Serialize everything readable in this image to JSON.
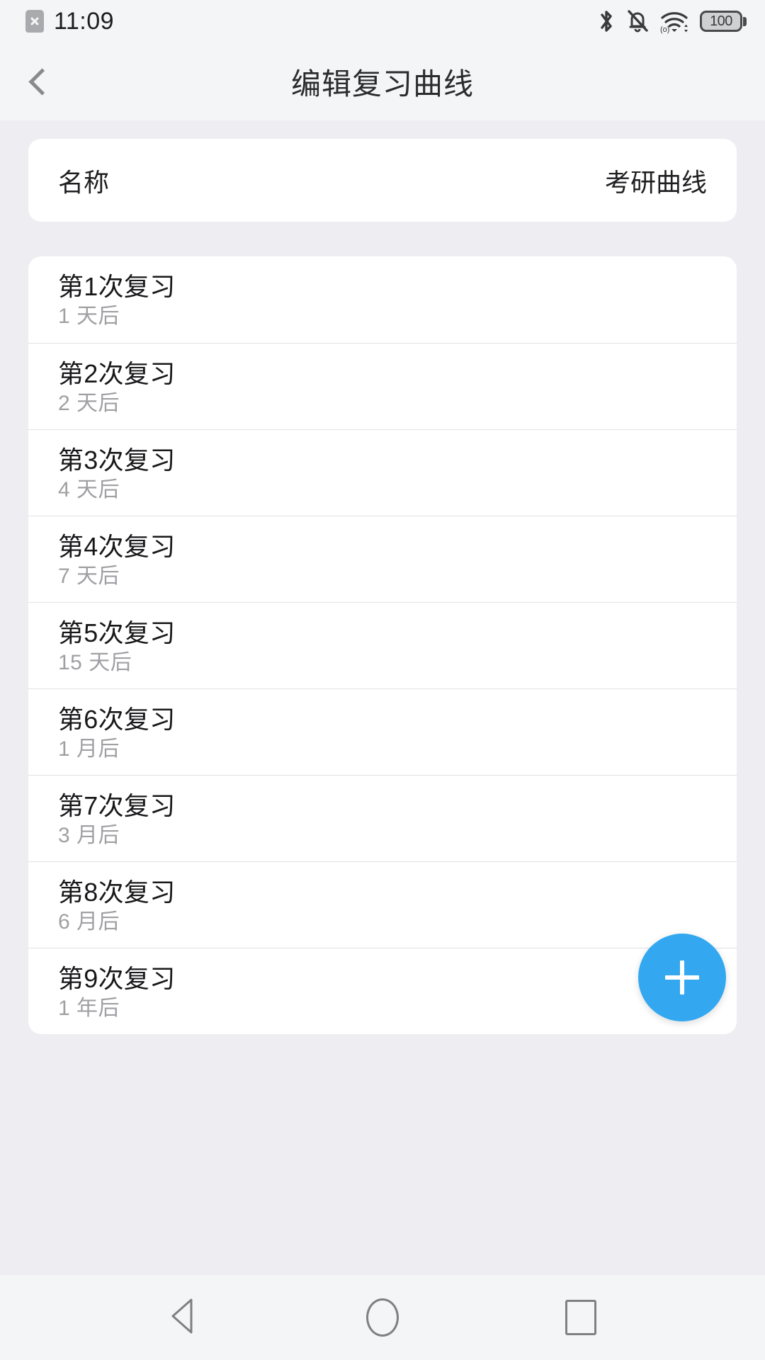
{
  "status_bar": {
    "sim_icon": "sim-card-off-icon",
    "time": "11:09",
    "icons": [
      "bluetooth-icon",
      "notifications-off-icon",
      "wifi-icon"
    ],
    "battery_level": "100"
  },
  "header": {
    "back_icon": "back-chevron-icon",
    "title": "编辑复习曲线"
  },
  "name_card": {
    "label": "名称",
    "value": "考研曲线"
  },
  "review_list": [
    {
      "title": "第1次复习",
      "interval": "1 天后"
    },
    {
      "title": "第2次复习",
      "interval": "2 天后"
    },
    {
      "title": "第3次复习",
      "interval": "4 天后"
    },
    {
      "title": "第4次复习",
      "interval": "7 天后"
    },
    {
      "title": "第5次复习",
      "interval": "15 天后"
    },
    {
      "title": "第6次复习",
      "interval": "1 月后"
    },
    {
      "title": "第7次复习",
      "interval": "3 月后"
    },
    {
      "title": "第8次复习",
      "interval": "6 月后"
    },
    {
      "title": "第9次复习",
      "interval": "1 年后"
    }
  ],
  "fab": {
    "icon": "plus-icon",
    "color": "#33a8f0"
  },
  "nav_bar": {
    "back": "nav-back-icon",
    "home": "nav-home-icon",
    "recents": "nav-recents-icon"
  },
  "colors": {
    "accent": "#33a8f0",
    "page_bg": "#eeeef2",
    "card_bg": "#ffffff",
    "bar_bg": "#f4f5f7",
    "primary_text": "#18181a",
    "secondary_text": "#a0a0a4"
  }
}
